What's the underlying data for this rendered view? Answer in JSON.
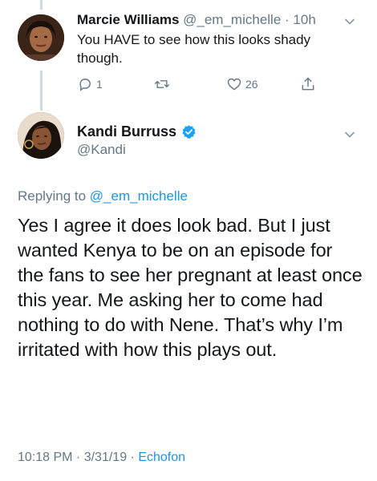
{
  "reply": {
    "name": "Marcie Williams",
    "handle": "@_em_michelle",
    "separator": "·",
    "time": "10h",
    "text": "You HAVE to see how this looks shady though.",
    "reply_count": "1",
    "like_count": "26"
  },
  "tweet": {
    "name": "Kandi Burruss",
    "handle": "@Kandi",
    "replying_label": "Replying to",
    "replying_to": "@_em_michelle",
    "text": "Yes I agree it does look bad. But I just wanted Kenya to be on an episode for the fans to see her pregnant at least once this year. Me asking her to come had nothing to do with Nene. That’s why I’m irritated with how this plays out.",
    "timestamp": "10:18 PM · 3/31/19 ·",
    "source": "Echofon"
  },
  "colors": {
    "link": "#1b95e0",
    "muted": "#657786",
    "text": "#14171a",
    "verified": "#1da1f2"
  },
  "icons": [
    "reply-icon",
    "retweet-icon",
    "like-icon",
    "share-icon",
    "chevron-down-icon",
    "verified-badge-icon"
  ]
}
